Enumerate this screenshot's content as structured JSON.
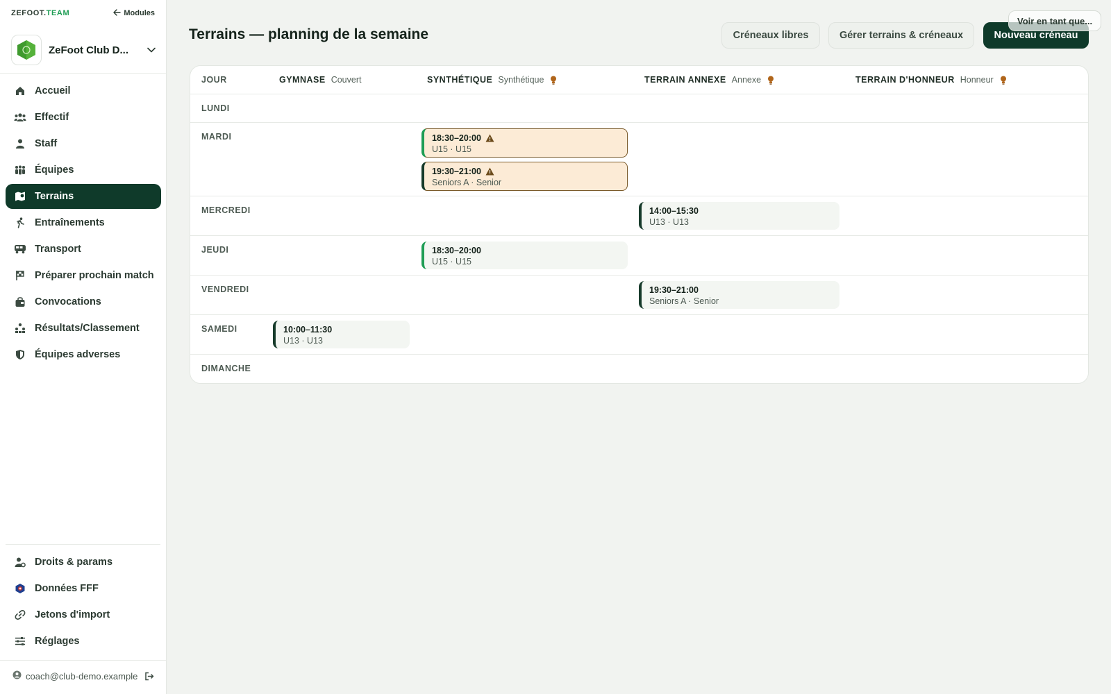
{
  "sidebar": {
    "brand_main": "ZEFOOT.",
    "brand_accent": "TEAM",
    "modules_label": "Modules",
    "club_name": "ZeFoot Club D...",
    "items": [
      {
        "label": "Accueil",
        "icon": "home-icon"
      },
      {
        "label": "Effectif",
        "icon": "users-icon"
      },
      {
        "label": "Staff",
        "icon": "staff-icon"
      },
      {
        "label": "Équipes",
        "icon": "teams-icon"
      },
      {
        "label": "Terrains",
        "icon": "map-pin-icon",
        "active": true
      },
      {
        "label": "Entraînements",
        "icon": "running-icon"
      },
      {
        "label": "Transport",
        "icon": "bus-icon"
      },
      {
        "label": "Préparer prochain match",
        "icon": "flag-icon"
      },
      {
        "label": "Convocations",
        "icon": "bag-icon"
      },
      {
        "label": "Résultats/Classement",
        "icon": "podium-icon"
      },
      {
        "label": "Équipes adverses",
        "icon": "shield-icon"
      }
    ],
    "bottom_items": [
      {
        "label": "Droits & params",
        "icon": "user-gear-icon"
      },
      {
        "label": "Données FFF",
        "icon": "fff-icon"
      },
      {
        "label": "Jetons d'import",
        "icon": "link-icon"
      },
      {
        "label": "Réglages",
        "icon": "sliders-icon"
      }
    ],
    "user_email": "coach@club-demo.example"
  },
  "header": {
    "title": "Terrains — planning de la semaine",
    "btn_free_slots": "Créneaux libres",
    "btn_manage": "Gérer terrains & créneaux",
    "btn_new": "Nouveau créneau",
    "view_as": "Voir en tant que..."
  },
  "grid": {
    "day_header": "JOUR",
    "fields": [
      {
        "name": "GYMNASE",
        "type": "Couvert",
        "lit": false
      },
      {
        "name": "SYNTHÉTIQUE",
        "type": "Synthétique",
        "lit": true
      },
      {
        "name": "TERRAIN ANNEXE",
        "type": "Annexe",
        "lit": true
      },
      {
        "name": "TERRAIN D'HONNEUR",
        "type": "Honneur",
        "lit": true
      }
    ],
    "days": [
      "LUNDI",
      "MARDI",
      "MERCREDI",
      "JEUDI",
      "VENDREDI",
      "SAMEDI",
      "DIMANCHE"
    ],
    "slots": [
      {
        "day": 1,
        "field": 1,
        "time": "18:30–20:00",
        "team": "U15 · U15",
        "warning": true,
        "accent": "green"
      },
      {
        "day": 1,
        "field": 1,
        "time": "19:30–21:00",
        "team": "Seniors A · Senior",
        "warning": true,
        "accent": "dark"
      },
      {
        "day": 2,
        "field": 2,
        "time": "14:00–15:30",
        "team": "U13 · U13",
        "warning": false,
        "accent": "dark"
      },
      {
        "day": 3,
        "field": 1,
        "time": "18:30–20:00",
        "team": "U15 · U15",
        "warning": false,
        "accent": "green"
      },
      {
        "day": 4,
        "field": 2,
        "time": "19:30–21:00",
        "team": "Seniors A · Senior",
        "warning": false,
        "accent": "dark"
      },
      {
        "day": 5,
        "field": 0,
        "time": "10:00–11:30",
        "team": "U13 · U13",
        "warning": false,
        "accent": "dark"
      }
    ]
  },
  "colors": {
    "primary": "#0f3a2a",
    "accent_green": "#1f9d55",
    "warning_bg": "#fcebd6",
    "warning_icon": "#6b4a1a",
    "bulb": "#b0651a"
  }
}
